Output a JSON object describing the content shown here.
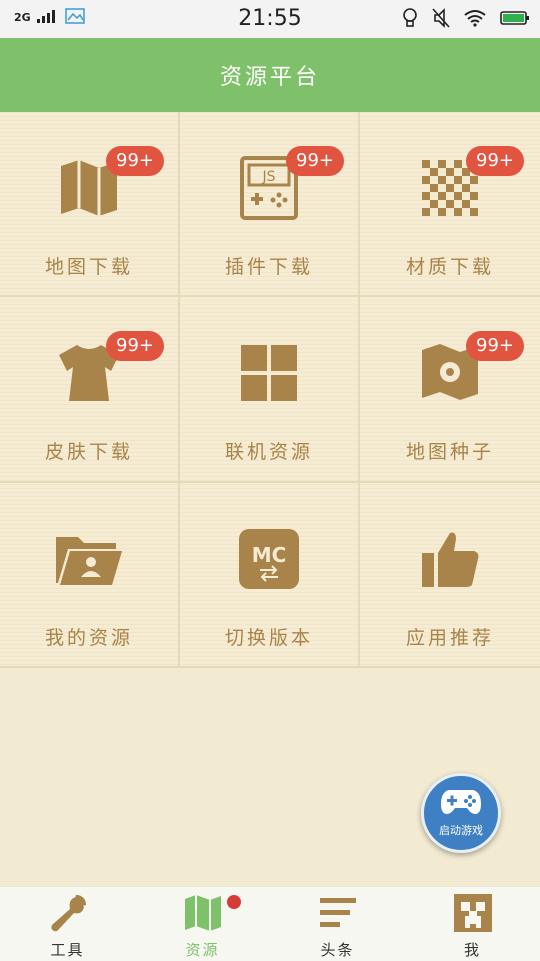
{
  "status_bar": {
    "network": "2G",
    "time": "21:55"
  },
  "header": {
    "title": "资源平台"
  },
  "grid": [
    {
      "label": "地图下载",
      "badge": "99+",
      "icon": "map-icon"
    },
    {
      "label": "插件下载",
      "badge": "99+",
      "icon": "js-console-icon"
    },
    {
      "label": "材质下载",
      "badge": "99+",
      "icon": "checker-texture-icon"
    },
    {
      "label": "皮肤下载",
      "badge": "99+",
      "icon": "shirt-icon"
    },
    {
      "label": "联机资源",
      "badge": "",
      "icon": "four-squares-icon"
    },
    {
      "label": "地图种子",
      "badge": "99+",
      "icon": "map-seed-icon"
    },
    {
      "label": "我的资源",
      "badge": "",
      "icon": "folder-user-icon"
    },
    {
      "label": "切换版本",
      "badge": "",
      "icon": "mc-switch-icon",
      "icon_text": "MC"
    },
    {
      "label": "应用推荐",
      "badge": "",
      "icon": "thumbs-up-icon"
    }
  ],
  "fab": {
    "label": "启动游戏",
    "icon": "gamepad-icon"
  },
  "tabbar": [
    {
      "label": "工具",
      "icon": "wrench-icon",
      "active": false
    },
    {
      "label": "资源",
      "icon": "map-icon",
      "active": true,
      "dot": true
    },
    {
      "label": "头条",
      "icon": "headlines-icon",
      "active": false
    },
    {
      "label": "我",
      "icon": "creeper-icon",
      "active": false
    }
  ],
  "colors": {
    "accent": "#7fc16a",
    "icon": "#a9844a",
    "badge": "#e15440",
    "fab": "#3f7fc4"
  }
}
